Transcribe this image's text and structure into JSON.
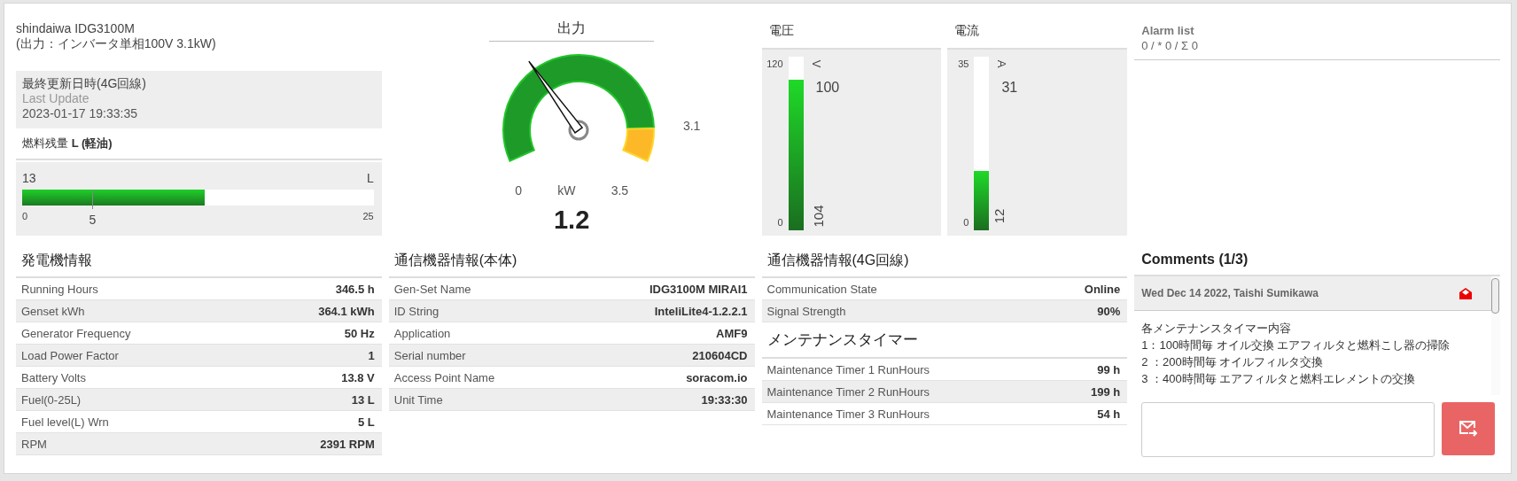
{
  "device": {
    "title": "shindaiwa IDG3100M",
    "subtitle": "(出力：インバータ単相100V 3.1kW)"
  },
  "last_update": {
    "label": "最終更新日時(4G回線)",
    "sublabel": "Last Update",
    "value": "2023-01-17 19:33:35"
  },
  "fuel": {
    "title": "燃料残量 **L (軽油)**",
    "value": "13",
    "unit": "L",
    "level": 0.52,
    "min": "0",
    "max": "25",
    "marker": {
      "label": "5",
      "level": 0.2
    }
  },
  "gauge": {
    "title": "出力",
    "level": 0.343,
    "warning": {
      "label": "3.1",
      "level": 0.886
    },
    "min": "0",
    "unit": "kW",
    "max": "3.5",
    "value": "1.2"
  },
  "meters": [
    {
      "title": "電圧",
      "max": "120",
      "min": "0",
      "unit": "V",
      "setpoint": "100",
      "value": "104",
      "level": 0.867
    },
    {
      "title": "電流",
      "max": "35",
      "min": "0",
      "unit": "A",
      "setpoint": "31",
      "value": "12",
      "level": 0.343
    }
  ],
  "alarm_list": {
    "title": "Alarm list",
    "counts": "0 / * 0 / Σ 0"
  },
  "generator_info": {
    "title": "発電機情報",
    "rows": [
      {
        "label": "Running Hours",
        "value": "346.5 h"
      },
      {
        "label": "Genset kWh",
        "value": "364.1 kWh"
      },
      {
        "label": "Generator Frequency",
        "value": "50 Hz"
      },
      {
        "label": "Load Power Factor",
        "value": "1"
      },
      {
        "label": "Battery Volts",
        "value": "13.8 V"
      },
      {
        "label": "Fuel(0-25L)",
        "value": "13 L"
      },
      {
        "label": "Fuel level(L) Wrn",
        "value": "5 L"
      },
      {
        "label": "RPM",
        "value": "2391 RPM"
      }
    ]
  },
  "comm_unit_info": {
    "title": "通信機器情報(本体)",
    "rows": [
      {
        "label": "Gen-Set Name",
        "value": "IDG3100M MIRAI1"
      },
      {
        "label": "ID String",
        "value": "InteliLite4-1.2.2.1"
      },
      {
        "label": "Application",
        "value": "AMF9"
      },
      {
        "label": "Serial number",
        "value": "210604CD"
      },
      {
        "label": "Access Point Name",
        "value": "soracom.io"
      },
      {
        "label": "Unit Time",
        "value": "19:33:30"
      }
    ]
  },
  "comm_4g_info": {
    "title": "通信機器情報(4G回線)",
    "rows": [
      {
        "label": "Communication State",
        "value": "Online"
      },
      {
        "label": "Signal Strength",
        "value": "90%"
      }
    ]
  },
  "maintenance_timer": {
    "title": "メンテナンスタイマー",
    "rows": [
      {
        "label": "Maintenance Timer 1 RunHours",
        "value": "99 h"
      },
      {
        "label": "Maintenance Timer 2 RunHours",
        "value": "199 h"
      },
      {
        "label": "Maintenance Timer 3 RunHours",
        "value": "54 h"
      }
    ]
  },
  "comments": {
    "title": "Comments (1/3)",
    "entries": [
      {
        "header": "Wed Dec 14 2022, Taishi Sumikawa",
        "read": true,
        "lines": [
          "各メンテナンスタイマー内容",
          "1：100時間毎 オイル交換 エアフィルタと燃料こし器の掃除",
          "2 ：200時間毎 オイルフィルタ交換",
          "3 ：400時間毎 エアフィルタと燃料エレメントの交換"
        ]
      }
    ]
  }
}
